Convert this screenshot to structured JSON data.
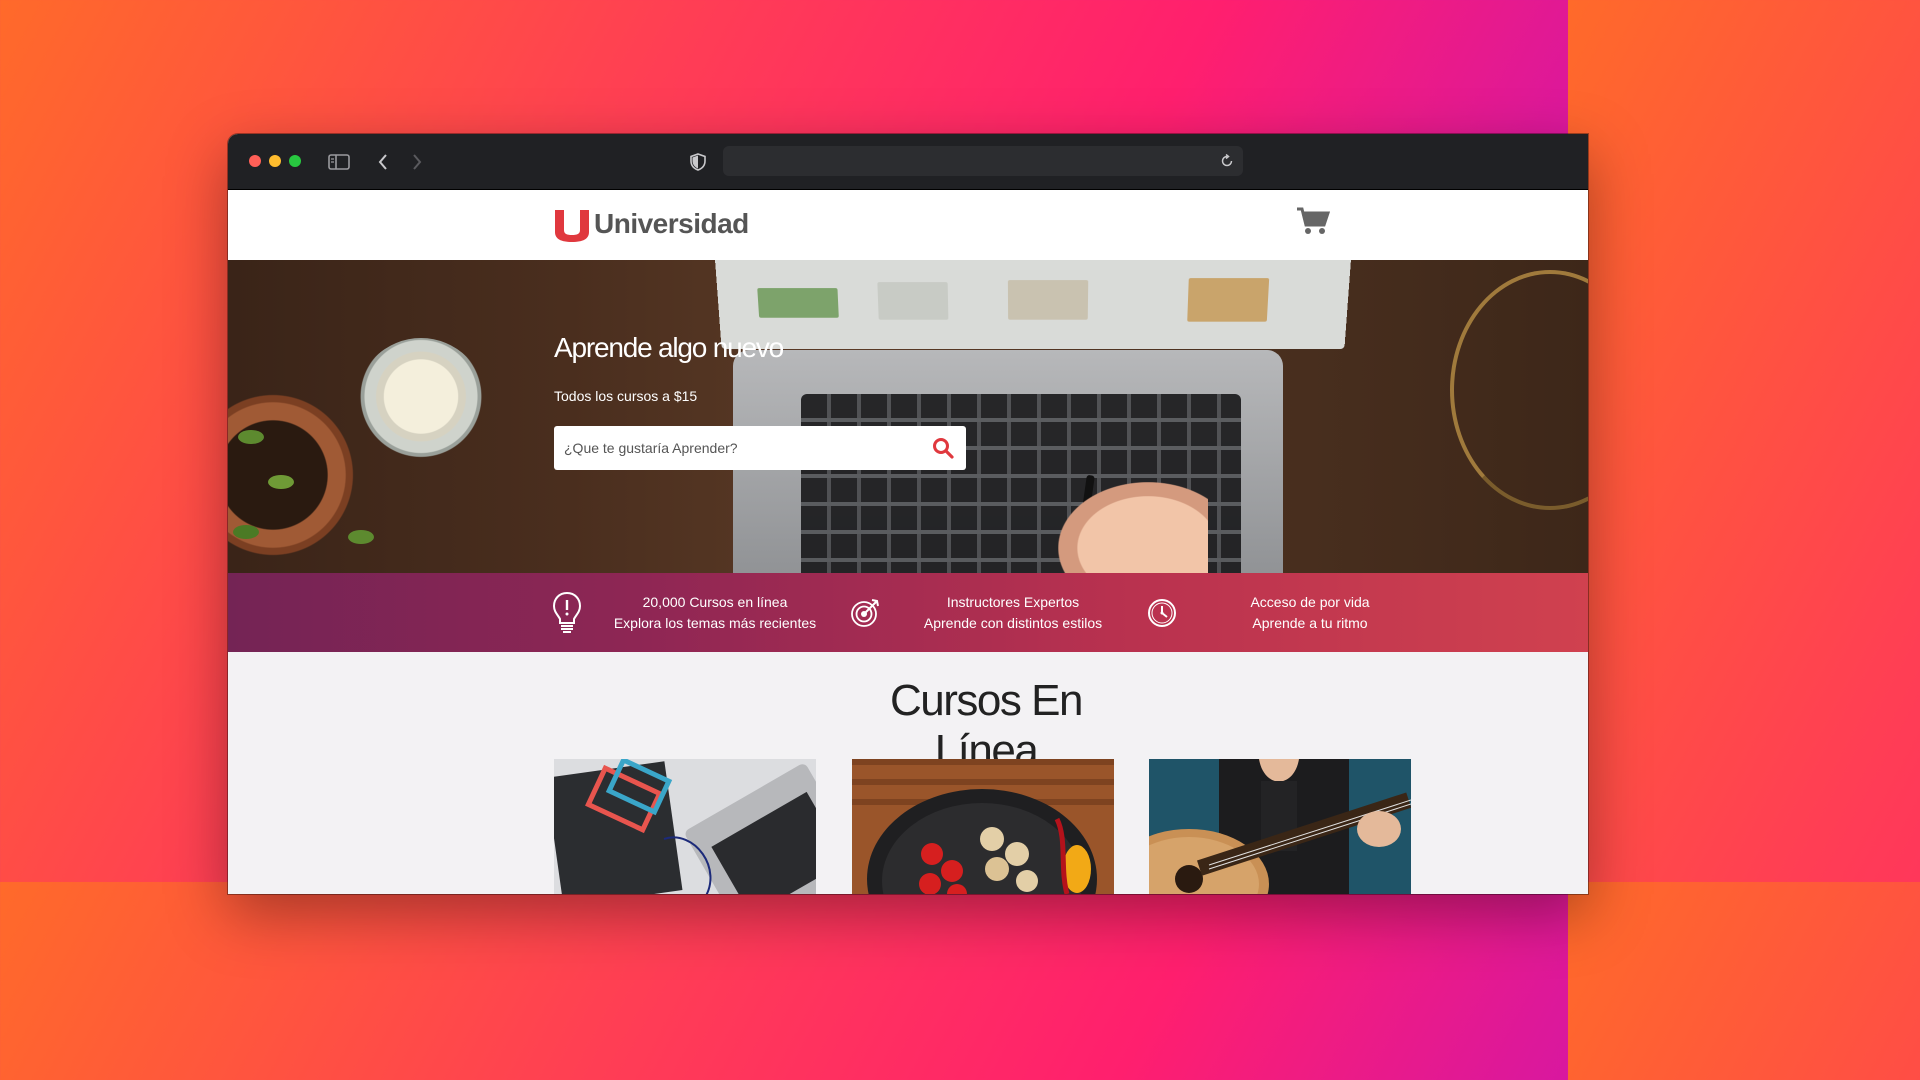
{
  "browser": {
    "address": ""
  },
  "header": {
    "logo_text": "Universidad"
  },
  "hero": {
    "title": "Aprende algo nuevo",
    "subtitle": "Todos los cursos a $15",
    "search_placeholder": "¿Que te gustaría Aprender?"
  },
  "features": [
    {
      "icon": "lightbulb-icon",
      "line1": "20,000 Cursos en línea",
      "line2": "Explora los temas más recientes"
    },
    {
      "icon": "target-icon",
      "line1": "Instructores Expertos",
      "line2": "Aprende con distintos estilos"
    },
    {
      "icon": "clock-icon",
      "line1": "Acceso de por vida",
      "line2": "Aprende a tu ritmo"
    }
  ],
  "courses": {
    "title": "Cursos En Línea",
    "cards": [
      {
        "image": "html-css-book-laptop"
      },
      {
        "image": "vegetables-pan"
      },
      {
        "image": "guitar-player"
      }
    ]
  },
  "colors": {
    "brand_red": "#e0383e",
    "feature_gradient_start": "#742455",
    "feature_gradient_end": "#d0414f"
  }
}
